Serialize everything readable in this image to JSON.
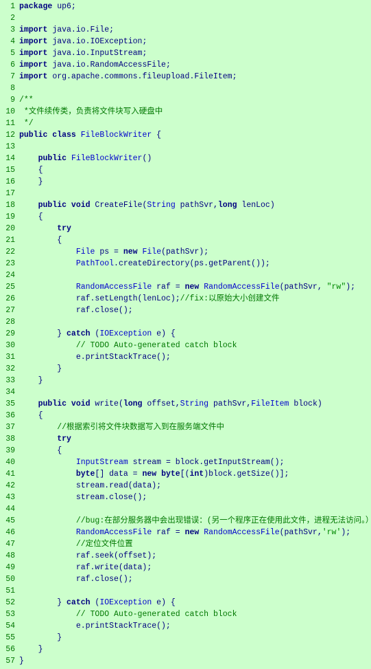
{
  "lines": [
    {
      "num": 1,
      "content": "package up6;",
      "type": "code"
    },
    {
      "num": 2,
      "content": "",
      "type": "blank"
    },
    {
      "num": 3,
      "content": "import java.io.File;",
      "type": "code"
    },
    {
      "num": 4,
      "content": "import java.io.IOException;",
      "type": "code"
    },
    {
      "num": 5,
      "content": "import java.io.InputStream;",
      "type": "code"
    },
    {
      "num": 6,
      "content": "import java.io.RandomAccessFile;",
      "type": "code"
    },
    {
      "num": 7,
      "content": "import org.apache.commons.fileupload.FileItem;",
      "type": "code"
    },
    {
      "num": 8,
      "content": "",
      "type": "blank"
    },
    {
      "num": 9,
      "content": "/**",
      "type": "comment"
    },
    {
      "num": 10,
      "content": " *文件续传类，负责将文件块写入硬盘中",
      "type": "comment"
    },
    {
      "num": 11,
      "content": " */",
      "type": "comment"
    },
    {
      "num": 12,
      "content": "public class FileBlockWriter {",
      "type": "code"
    },
    {
      "num": 13,
      "content": "",
      "type": "blank"
    },
    {
      "num": 14,
      "content": "    public FileBlockWriter()",
      "type": "code"
    },
    {
      "num": 15,
      "content": "    {",
      "type": "code"
    },
    {
      "num": 16,
      "content": "    }",
      "type": "code"
    },
    {
      "num": 17,
      "content": "",
      "type": "blank"
    },
    {
      "num": 18,
      "content": "    public void CreateFile(String pathSvr,long lenLoc)",
      "type": "code"
    },
    {
      "num": 19,
      "content": "    {",
      "type": "code"
    },
    {
      "num": 20,
      "content": "        try",
      "type": "code"
    },
    {
      "num": 21,
      "content": "        {",
      "type": "code"
    },
    {
      "num": 22,
      "content": "            File ps = new File(pathSvr);",
      "type": "code"
    },
    {
      "num": 23,
      "content": "            PathTool.createDirectory(ps.getParent());",
      "type": "code"
    },
    {
      "num": 24,
      "content": "",
      "type": "blank"
    },
    {
      "num": 25,
      "content": "            RandomAccessFile raf = new RandomAccessFile(pathSvr, \"rw\");",
      "type": "code"
    },
    {
      "num": 26,
      "content": "            raf.setLength(lenLoc);//fix:以原始大小创建文件",
      "type": "code"
    },
    {
      "num": 27,
      "content": "            raf.close();",
      "type": "code"
    },
    {
      "num": 28,
      "content": "",
      "type": "blank"
    },
    {
      "num": 29,
      "content": "        } catch (IOException e) {",
      "type": "code"
    },
    {
      "num": 30,
      "content": "            // TODO Auto-generated catch block",
      "type": "comment"
    },
    {
      "num": 31,
      "content": "            e.printStackTrace();",
      "type": "code"
    },
    {
      "num": 32,
      "content": "        }",
      "type": "code"
    },
    {
      "num": 33,
      "content": "    }",
      "type": "code"
    },
    {
      "num": 34,
      "content": "",
      "type": "blank"
    },
    {
      "num": 35,
      "content": "    public void write(long offset,String pathSvr,FileItem block)",
      "type": "code"
    },
    {
      "num": 36,
      "content": "    {",
      "type": "code"
    },
    {
      "num": 37,
      "content": "        //根据索引将文件块数据写入到在服务端文件中",
      "type": "comment"
    },
    {
      "num": 38,
      "content": "        try",
      "type": "code"
    },
    {
      "num": 39,
      "content": "        {",
      "type": "code"
    },
    {
      "num": 40,
      "content": "            InputStream stream = block.getInputStream();",
      "type": "code"
    },
    {
      "num": 41,
      "content": "            byte[] data = new byte[(int)block.getSize()];",
      "type": "code"
    },
    {
      "num": 42,
      "content": "            stream.read(data);",
      "type": "code"
    },
    {
      "num": 43,
      "content": "            stream.close();",
      "type": "code"
    },
    {
      "num": 44,
      "content": "",
      "type": "blank"
    },
    {
      "num": 45,
      "content": "            //bug:在部分服务器中会出现错误：(另一个程序正在使用此文件，进程无法访问。）",
      "type": "comment"
    },
    {
      "num": 46,
      "content": "            RandomAccessFile raf = new RandomAccessFile(pathSvr,'rw');",
      "type": "code"
    },
    {
      "num": 47,
      "content": "            //定位文件位置",
      "type": "comment"
    },
    {
      "num": 48,
      "content": "            raf.seek(offset);",
      "type": "code"
    },
    {
      "num": 49,
      "content": "            raf.write(data);",
      "type": "code"
    },
    {
      "num": 50,
      "content": "            raf.close();",
      "type": "code"
    },
    {
      "num": 51,
      "content": "",
      "type": "blank"
    },
    {
      "num": 52,
      "content": "        } catch (IOException e) {",
      "type": "code"
    },
    {
      "num": 53,
      "content": "            // TODO Auto-generated catch block",
      "type": "comment"
    },
    {
      "num": 54,
      "content": "            e.printStackTrace();",
      "type": "code"
    },
    {
      "num": 55,
      "content": "        }",
      "type": "code"
    },
    {
      "num": 56,
      "content": "    }",
      "type": "code"
    },
    {
      "num": 57,
      "content": "}",
      "type": "code"
    }
  ]
}
